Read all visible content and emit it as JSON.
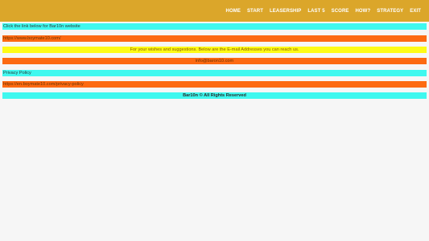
{
  "nav": {
    "items": [
      "HOME",
      "START",
      "LEASERSHIP",
      "LAST 5",
      "SCORE",
      "HOW?",
      "STRATEGY",
      "EXIT"
    ]
  },
  "content": {
    "website_prompt": "Click the link below for Bar10n website",
    "website_url": "https://www.boymate10.com/",
    "contact_prompt": "For your wishes and suggestions. Below are the E-mail Addresses you can reach us.",
    "contact_email": "info@baron10.com",
    "privacy_label": "Privacy Policy",
    "privacy_url": "https://en.boymate10.com/privacy-policy",
    "footer": "Bar10n © All Rights Reserved"
  },
  "colors": {
    "header": "#dba62a",
    "cyan": "#3ff8ef",
    "orange": "#fd6a12",
    "yellow": "#fefb16"
  }
}
